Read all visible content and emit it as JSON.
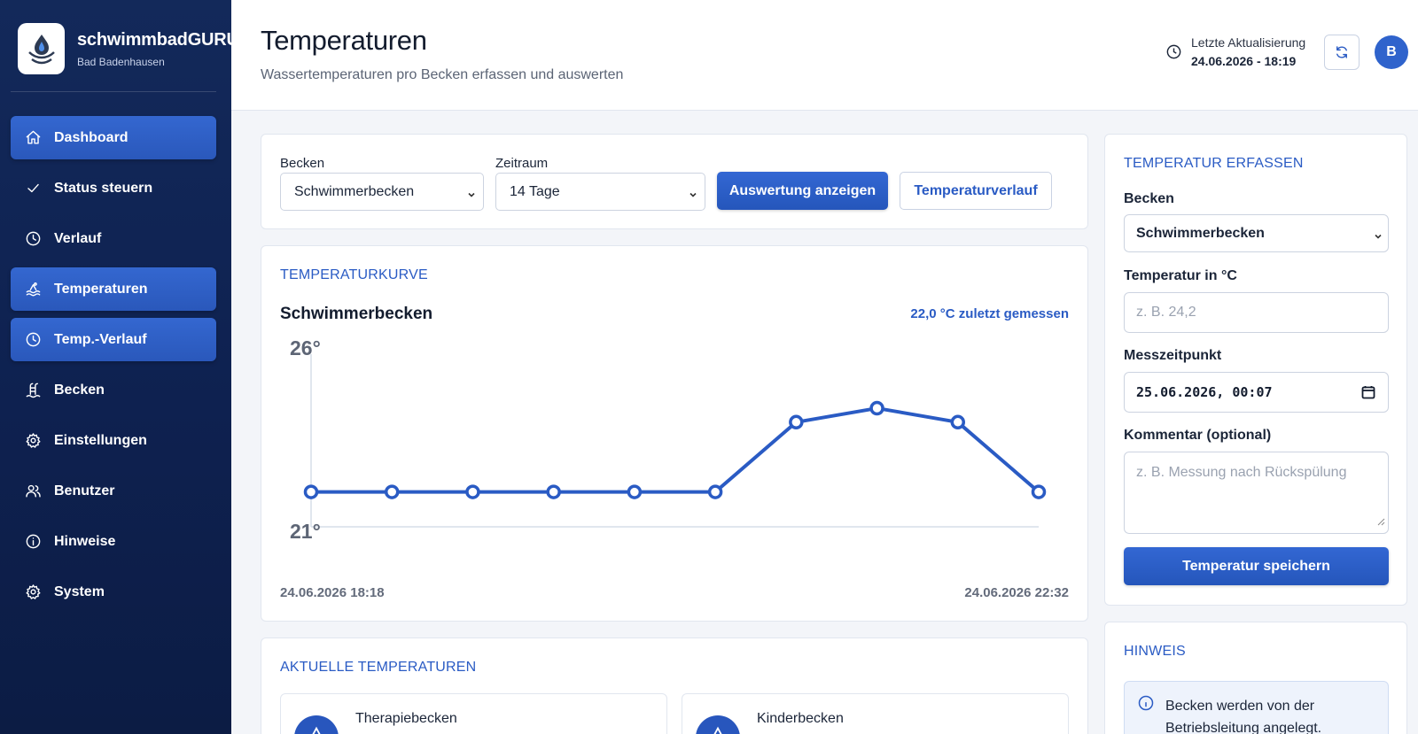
{
  "app": {
    "name": "schwimmbadGURU",
    "location": "Bad Badenhausen",
    "user_initial": "B"
  },
  "sidebar": {
    "items": [
      {
        "label": "Dashboard",
        "icon": "home-icon",
        "active": true
      },
      {
        "label": "Status steuern",
        "icon": "check-icon",
        "active": false
      },
      {
        "label": "Verlauf",
        "icon": "clock-icon",
        "active": false
      },
      {
        "label": "Temperaturen",
        "icon": "water-waves-icon",
        "active": true
      },
      {
        "label": "Temp.-Verlauf",
        "icon": "clock-icon",
        "active": true
      },
      {
        "label": "Becken",
        "icon": "pool-ladder-icon",
        "active": false
      },
      {
        "label": "Einstellungen",
        "icon": "gear-icon",
        "active": false
      },
      {
        "label": "Benutzer",
        "icon": "users-icon",
        "active": false
      },
      {
        "label": "Hinweise",
        "icon": "info-icon",
        "active": false
      },
      {
        "label": "System",
        "icon": "gear-icon",
        "active": false
      }
    ]
  },
  "header": {
    "title": "Temperaturen",
    "subtitle": "Wassertemperaturen pro Becken erfassen und auswerten",
    "update_label": "Letzte Aktualisierung",
    "update_time": "24.06.2026 - 18:19"
  },
  "filter": {
    "pool_label": "Becken",
    "pool_value": "Schwimmerbecken",
    "range_label": "Zeitraum",
    "range_value": "14 Tage",
    "show_button": "Auswertung anzeigen",
    "history_button": "Temperaturverlauf"
  },
  "chart_card": {
    "title": "TEMPERATURKURVE",
    "pool": "Schwimmerbecken",
    "last_measured": "22,0 °C zuletzt gemessen",
    "start_label": "24.06.2026 18:18",
    "end_label": "24.06.2026 22:32"
  },
  "chart_data": {
    "type": "line",
    "title": "",
    "xlabel": "",
    "ylabel": "",
    "ylim": [
      21,
      26
    ],
    "y_tick_labels": [
      "26°",
      "21°"
    ],
    "values": [
      22.0,
      22.0,
      22.0,
      22.0,
      22.0,
      22.0,
      24.0,
      24.4,
      24.0,
      22.0
    ],
    "color": "#2a5bc4",
    "grid": false
  },
  "current": {
    "title": "AKTUELLE TEMPERATUREN",
    "pools": [
      {
        "name": "Therapiebecken"
      },
      {
        "name": "Kinderbecken"
      }
    ]
  },
  "form": {
    "title": "TEMPERATUR ERFASSEN",
    "pool_label": "Becken",
    "pool_value": "Schwimmerbecken",
    "temp_label": "Temperatur in °C",
    "temp_placeholder": "z. B. 24,2",
    "time_label": "Messzeitpunkt",
    "time_value": "25.06.2026, 00:07",
    "comment_label": "Kommentar (optional)",
    "comment_placeholder": "z. B. Messung nach Rückspülung",
    "save_button": "Temperatur speichern"
  },
  "hint": {
    "title": "HINWEIS",
    "text": "Becken werden von der Betriebsleitung angelegt."
  },
  "colors": {
    "accent": "#2a5bc4",
    "sidebar": "#0e2150"
  }
}
